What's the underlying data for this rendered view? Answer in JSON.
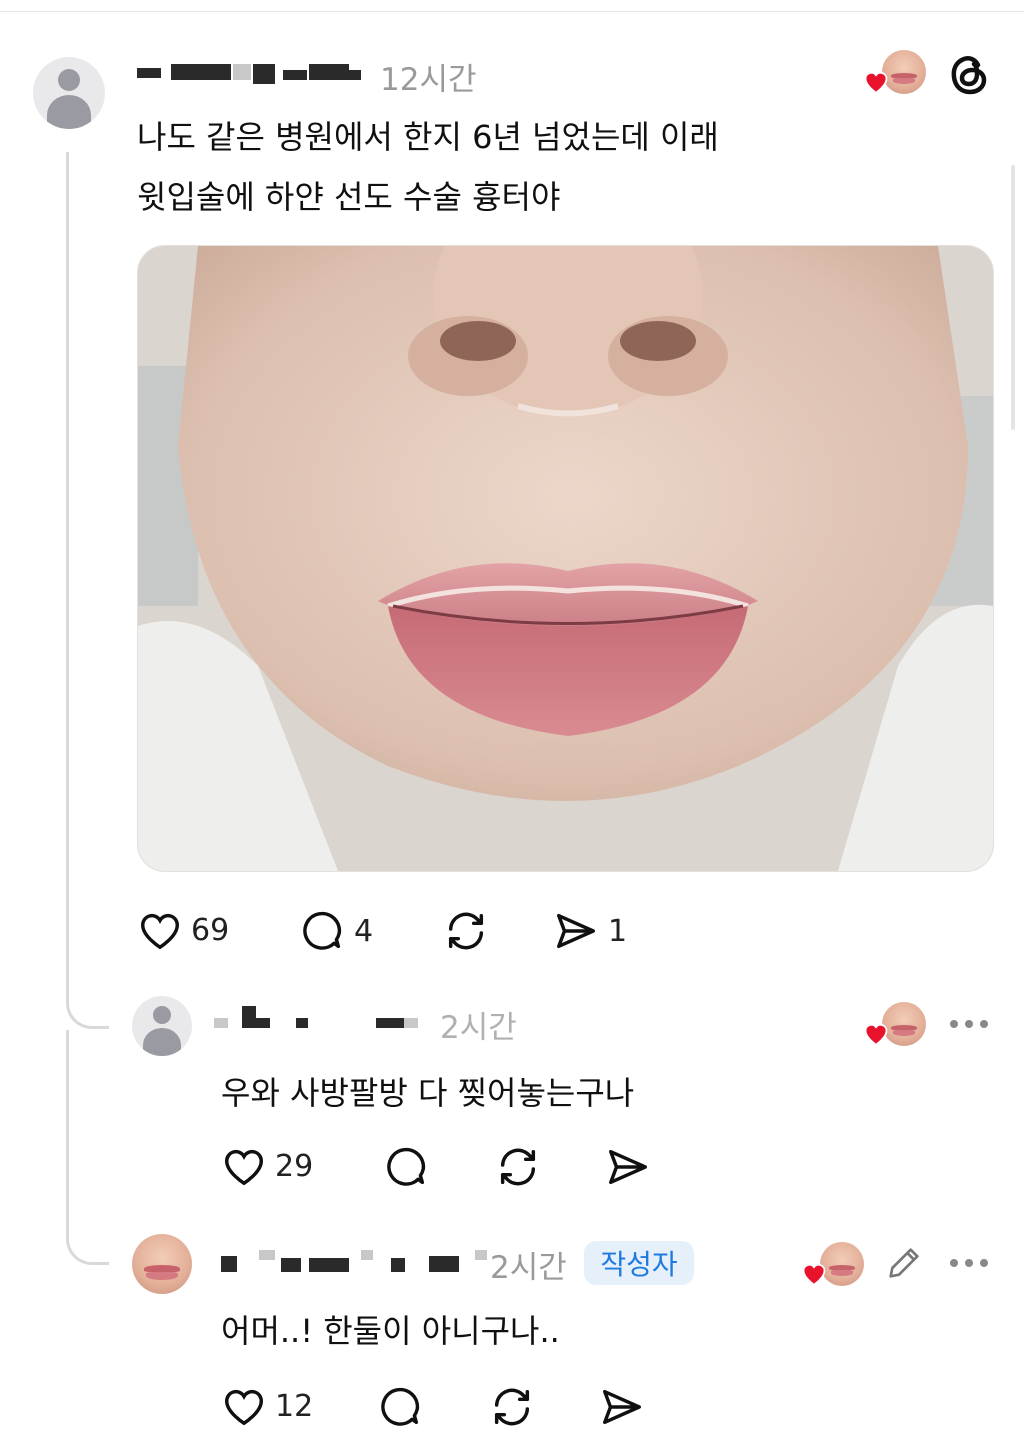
{
  "posts": [
    {
      "time": "12시간",
      "text_lines": [
        "나도 같은 병원에서 한지 6년 넘었는데 이래",
        "윗입술에 하얀 선도 수술 흉터야"
      ],
      "likes": "69",
      "comments": "4",
      "shares": "1"
    },
    {
      "time": "2시간",
      "text": "우와 사방팔방 다 찢어놓는구나",
      "likes": "29"
    },
    {
      "time": "2시간",
      "badge": "작성자",
      "text": "어머..! 한둘이 아니구나..",
      "likes": "12"
    }
  ],
  "icons": [
    "threads-logo-icon",
    "heart-icon",
    "comment-icon",
    "repost-icon",
    "send-icon",
    "more-icon",
    "edit-pencil-icon",
    "liked-heart-icon"
  ],
  "colors": {
    "accent_blue": "#1f7ae0",
    "like_red": "#e8122d",
    "muted": "#9a9a9a"
  }
}
